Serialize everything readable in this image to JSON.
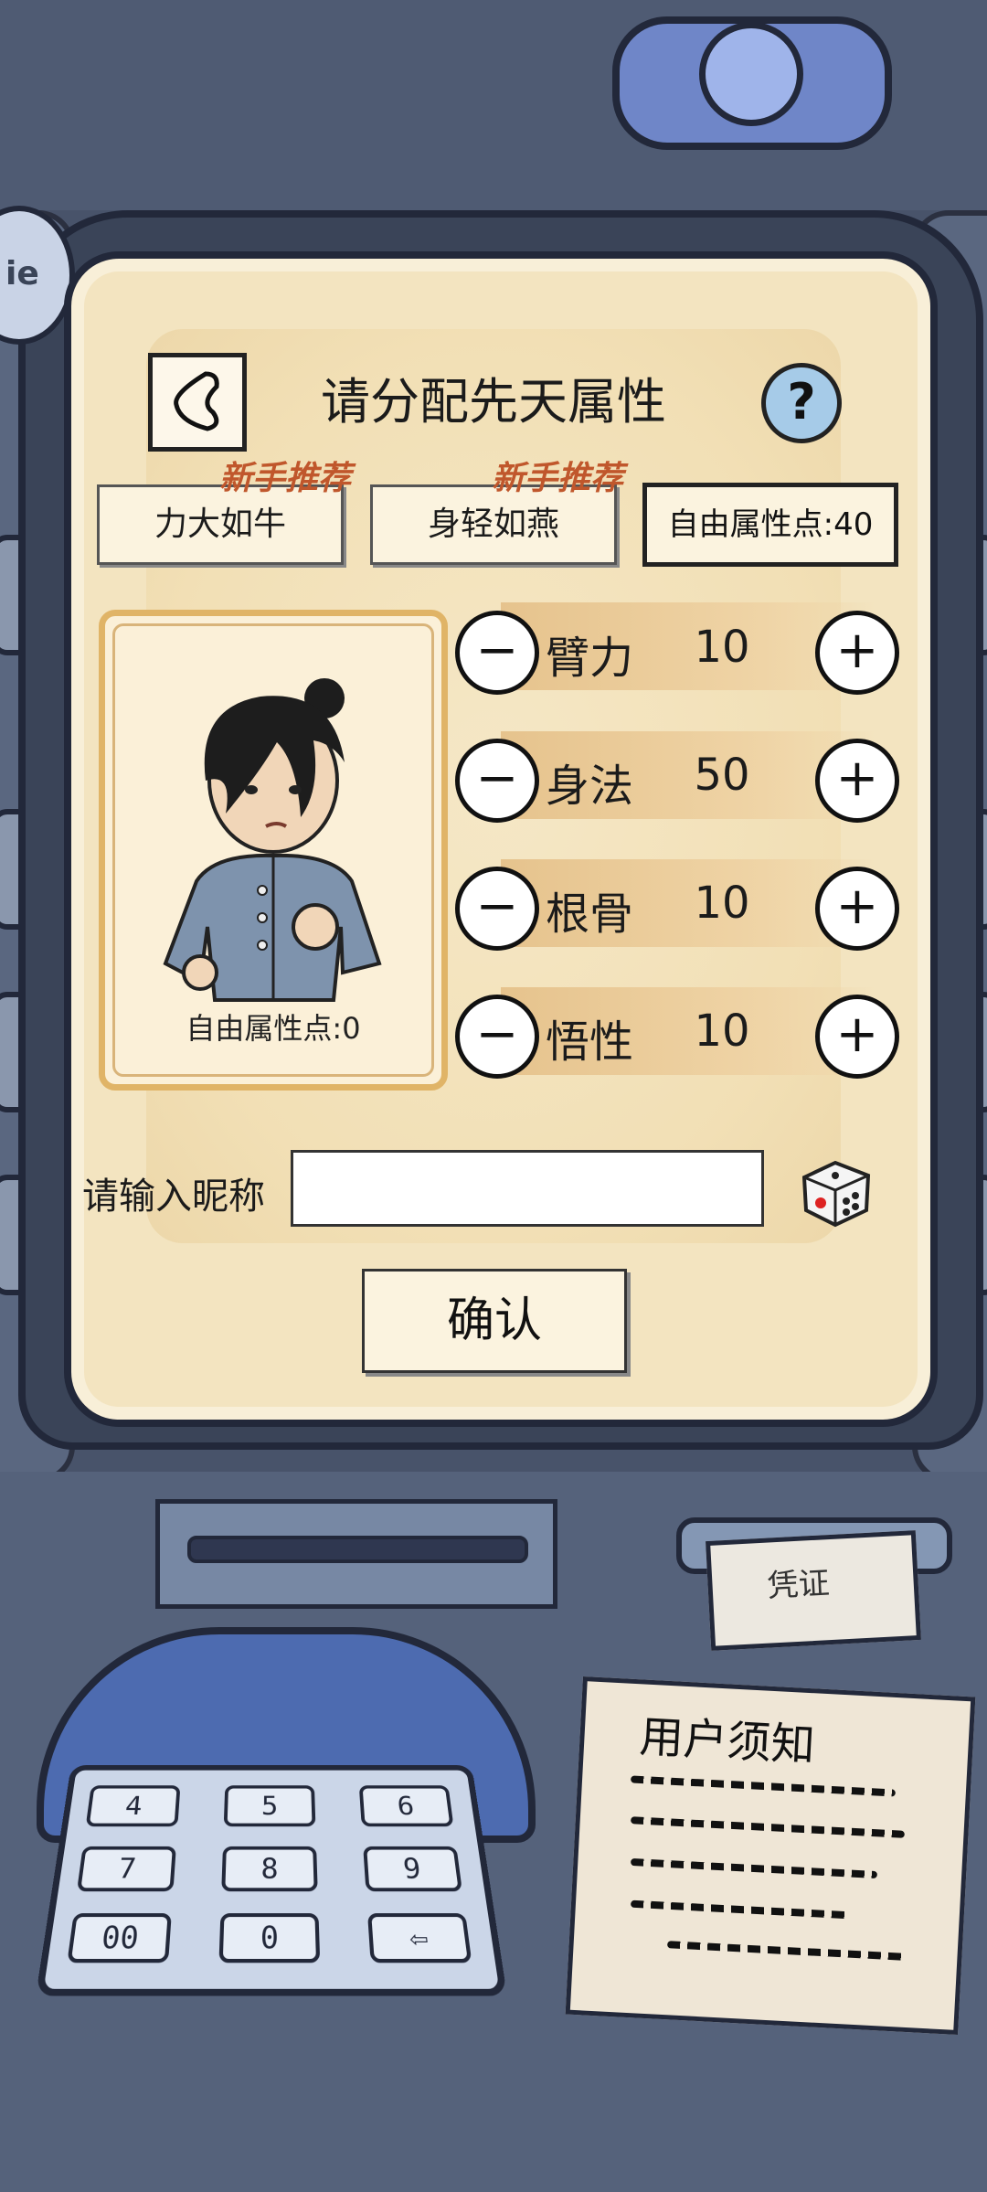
{
  "header": {
    "title": "请分配先天属性",
    "help_symbol": "?"
  },
  "presets": [
    {
      "label": "力大如牛",
      "tag": "新手推荐"
    },
    {
      "label": "身轻如燕",
      "tag": "新手推荐"
    }
  ],
  "free_points_box": "自由属性点:40",
  "portrait": {
    "free_points_label": "自由属性点:0"
  },
  "stats": [
    {
      "name": "臂力",
      "value": "10"
    },
    {
      "name": "身法",
      "value": "50"
    },
    {
      "name": "根骨",
      "value": "10"
    },
    {
      "name": "悟性",
      "value": "10"
    }
  ],
  "controls": {
    "minus": "−",
    "plus": "+"
  },
  "nickname": {
    "label": "请输入昵称",
    "value": "",
    "placeholder": ""
  },
  "confirm_label": "确认",
  "machine": {
    "keypad": [
      "4",
      "5",
      "6",
      "7",
      "8",
      "9",
      "00",
      "0",
      "⇦"
    ],
    "notice_title": "用户须知",
    "receipt_text": "凭证",
    "badge_text": "ie"
  }
}
